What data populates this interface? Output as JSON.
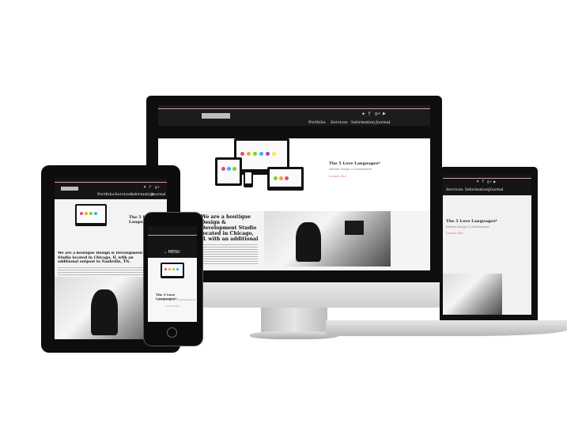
{
  "site": {
    "nav": [
      "Portfolio",
      "Services",
      "Information",
      "Journal"
    ],
    "social_icons": [
      "twitter-icon",
      "facebook-icon",
      "google-plus-icon",
      "youtube-icon"
    ],
    "hero_title": "The 5 Love Languages*",
    "hero_subtitle": "Website Design & Development",
    "hero_link": "Launch Site",
    "about_heading_desktop": "We are a boutique Design & Development Studio located in Chicago, IL with an additional outpost to Nashville, TN.",
    "about_heading_tablet": "We are a boutique Design & Development Studio located in Chicago, IL with an additional outpost to Nashville, TN.",
    "mobile_menu": "MENU",
    "mobile_menu_icon": "chevron-down-icon"
  },
  "colors": {
    "accent_pink": "#d99aa9",
    "bezel": "#0e0e0e",
    "dot_colors": [
      "#e84b7a",
      "#f5a623",
      "#7ed321",
      "#29b6f6",
      "#ab47bc",
      "#ffeb3b"
    ]
  }
}
